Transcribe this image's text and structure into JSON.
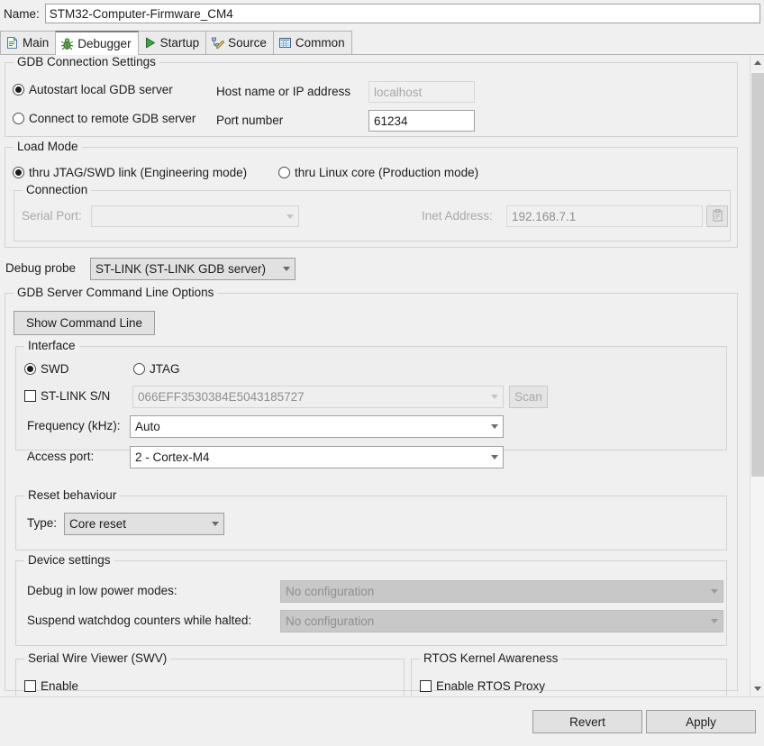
{
  "window": {
    "name_label": "Name:",
    "name_value": "STM32-Computer-Firmware_CM4"
  },
  "tabs": [
    {
      "label": "Main",
      "icon": "document-icon",
      "active": false
    },
    {
      "label": "Debugger",
      "icon": "bug-icon",
      "active": true
    },
    {
      "label": "Startup",
      "icon": "play-icon",
      "active": false
    },
    {
      "label": "Source",
      "icon": "edit-icon",
      "active": false
    },
    {
      "label": "Common",
      "icon": "table-icon",
      "active": false
    }
  ],
  "gdb_connection": {
    "legend": "GDB Connection Settings",
    "autostart_label": "Autostart local GDB server",
    "autostart_selected": true,
    "remote_label": "Connect to remote GDB server",
    "remote_selected": false,
    "host_label": "Host name or IP address",
    "host_value": "localhost",
    "host_disabled": true,
    "port_label": "Port number",
    "port_value": "61234"
  },
  "load_mode": {
    "legend": "Load Mode",
    "jtag_label": "thru JTAG/SWD link (Engineering mode)",
    "jtag_selected": true,
    "linux_label": "thru Linux core (Production mode)",
    "linux_selected": false,
    "connection": {
      "legend": "Connection",
      "serial_port_label": "Serial Port:",
      "serial_port_value": "",
      "inet_label": "Inet Address:",
      "inet_value": "192.168.7.1",
      "copy_icon": "clipboard-icon"
    }
  },
  "debug_probe": {
    "label": "Debug probe",
    "value": "ST-LINK (ST-LINK GDB server)"
  },
  "gdb_server_options": {
    "legend": "GDB Server Command Line Options",
    "show_command_line": "Show Command Line",
    "interface": {
      "legend": "Interface",
      "swd_label": "SWD",
      "swd_selected": true,
      "jtag_label": "JTAG",
      "jtag_selected": false,
      "serial_check_label": "ST-LINK S/N",
      "serial_checked": false,
      "serial_value": "066EFF3530384E5043185727",
      "scan_label": "Scan",
      "frequency_label": "Frequency (kHz):",
      "frequency_value": "Auto",
      "access_port_label": "Access port:",
      "access_port_value": "2 - Cortex-M4"
    },
    "reset_behaviour": {
      "legend": "Reset behaviour",
      "type_label": "Type:",
      "type_value": "Core reset"
    },
    "device_settings": {
      "legend": "Device settings",
      "low_power_label": "Debug in low power modes:",
      "low_power_value": "No configuration",
      "watchdog_label": "Suspend watchdog counters while halted:",
      "watchdog_value": "No configuration"
    },
    "swv": {
      "legend": "Serial Wire Viewer (SWV)",
      "enable_label": "Enable",
      "enabled": false
    },
    "rtos": {
      "legend": "RTOS Kernel Awareness",
      "enable_label": "Enable RTOS Proxy",
      "enabled": false
    }
  },
  "footer": {
    "revert_label": "Revert",
    "apply_label": "Apply"
  },
  "scrollbar": {
    "up_icon": "chevron-up-icon",
    "down_icon": "chevron-down-icon"
  }
}
